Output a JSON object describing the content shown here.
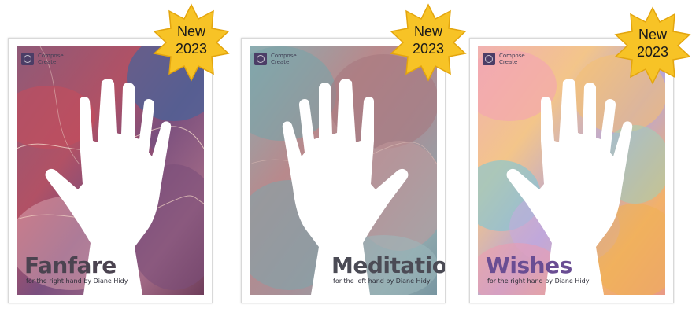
{
  "cards": [
    {
      "title": "Fanfare",
      "subtitle": "for the right hand by Diane Hidy",
      "title_color": "#4b4350",
      "hand": "right-hand-icon",
      "brand": [
        "Compose",
        "Create"
      ],
      "badge": {
        "line1": "New",
        "line2": "2023"
      }
    },
    {
      "title": "Meditation",
      "subtitle": "for the left hand by Diane Hidy",
      "title_color": "#4b4b55",
      "hand": "left-hand-icon",
      "brand": [
        "Compose",
        "Create"
      ],
      "badge": {
        "line1": "New",
        "line2": "2023"
      }
    },
    {
      "title": "Wishes",
      "subtitle": "for the right hand by Diane Hidy",
      "title_color": "#6a4d93",
      "hand": "right-hand-icon",
      "brand": [
        "Compose",
        "Create"
      ],
      "badge": {
        "line1": "New",
        "line2": "2023"
      }
    }
  ],
  "colors": {
    "badge_fill": "#f7c326",
    "badge_stroke": "#e3a50e"
  }
}
